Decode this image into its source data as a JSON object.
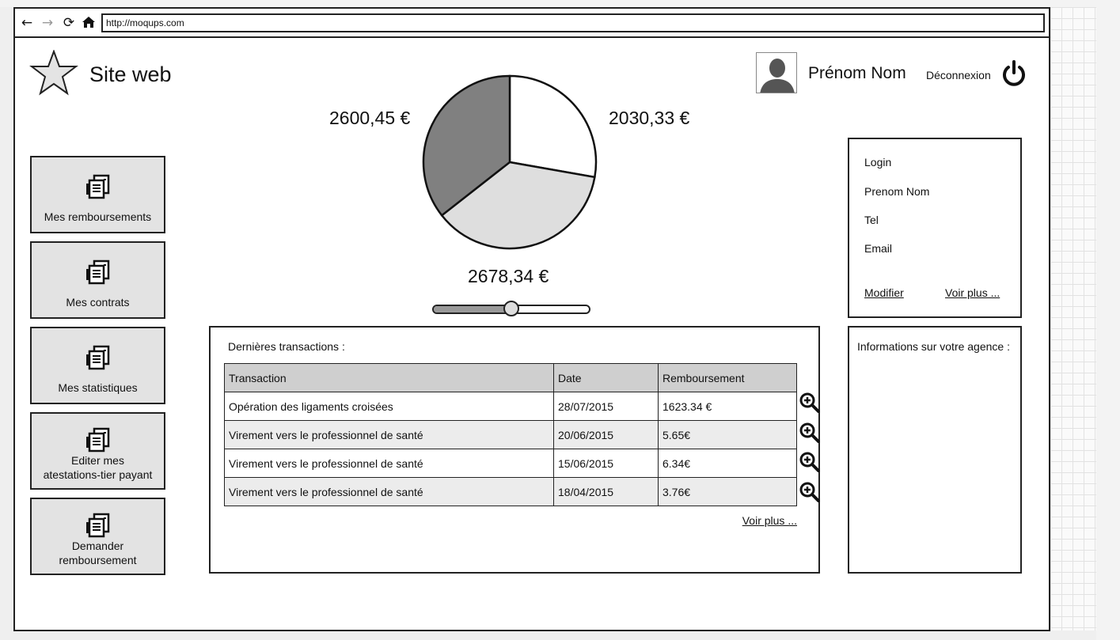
{
  "browser": {
    "url": "http://moqups.com",
    "nav": {
      "back_icon": "arrow-left-icon",
      "forward_icon": "arrow-right-icon",
      "reload_icon": "reload-icon",
      "home_icon": "home-icon"
    }
  },
  "header": {
    "logo_icon": "star-icon",
    "site_title": "Site web",
    "user_name": "Prénom Nom",
    "avatar_icon": "user-silhouette-icon",
    "logout_label": "Déconnexion",
    "logout_icon": "power-icon"
  },
  "menu": {
    "items": [
      {
        "label_lines": [
          "Mes remboursements"
        ],
        "icon": "documents-icon"
      },
      {
        "label_lines": [
          "Mes contrats"
        ],
        "icon": "documents-icon"
      },
      {
        "label_lines": [
          "Mes statistiques"
        ],
        "icon": "documents-icon"
      },
      {
        "label_lines": [
          "Editer mes",
          "atestations-tier payant"
        ],
        "icon": "documents-icon"
      },
      {
        "label_lines": [
          "Demander",
          "remboursement"
        ],
        "icon": "documents-icon"
      }
    ]
  },
  "chart_data": {
    "type": "pie",
    "title": "",
    "labels": [
      "2030,33 €",
      "2678,34 €",
      "2600,45 €"
    ],
    "values": [
      2030.33,
      2678.34,
      2600.45
    ],
    "colors": [
      "#ffffff",
      "#dedede",
      "#808080"
    ],
    "slider_value": 0.5
  },
  "transactions": {
    "title": "Dernières transactions :",
    "headers": [
      "Transaction",
      "Date",
      "Remboursement"
    ],
    "rows": [
      [
        "Opération des ligaments croisées",
        "28/07/2015",
        "1623.34 €"
      ],
      [
        "Virement vers le professionnel de santé",
        "20/06/2015",
        "5.65€"
      ],
      [
        "Virement vers le professionnel de santé",
        "15/06/2015",
        "6.34€"
      ],
      [
        "Virement vers le professionnel de santé",
        "18/04/2015",
        "3.76€"
      ]
    ],
    "row_action_icon": "zoom-in-icon",
    "more_link": "Voir plus ..."
  },
  "profile": {
    "fields": [
      "Login",
      "Prenom Nom",
      "Tel",
      "Email"
    ],
    "edit_link": "Modifier",
    "more_link": "Voir plus ..."
  },
  "agency": {
    "title": "Informations sur votre agence :"
  }
}
